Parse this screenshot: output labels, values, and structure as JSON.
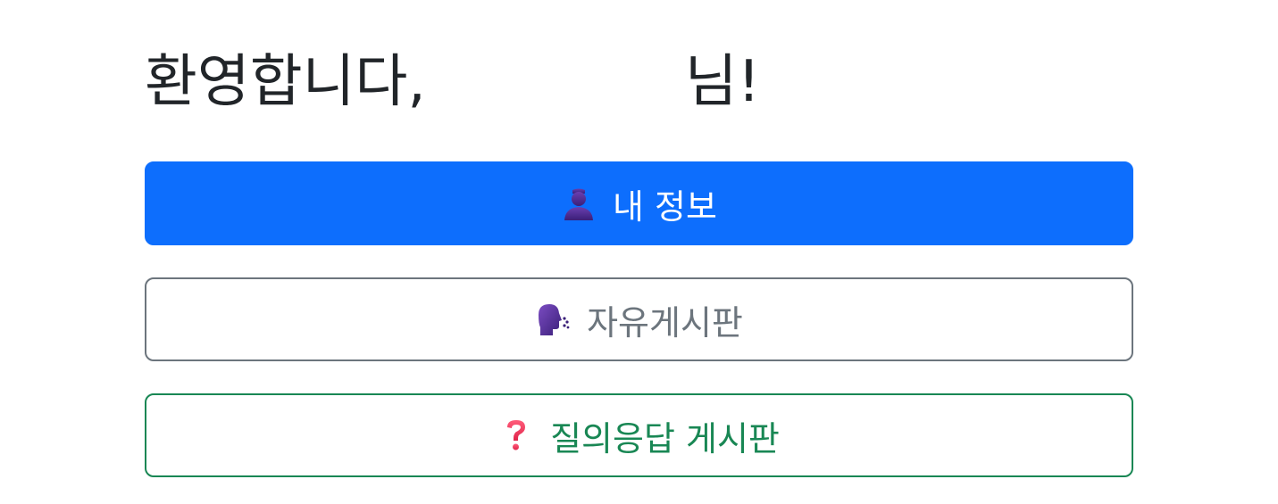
{
  "welcome": {
    "prefix": "환영합니다,",
    "username": "",
    "suffix": "님!"
  },
  "buttons": {
    "my_info": {
      "icon": "person-silhouette-icon",
      "label": "내 정보",
      "color": "#0d6efd"
    },
    "free_board": {
      "icon": "speaking-head-icon",
      "label": "자유게시판",
      "color": "#6c757d"
    },
    "qna_board": {
      "icon": "question-mark-icon",
      "label": "질의응답 게시판",
      "color": "#198754"
    }
  }
}
